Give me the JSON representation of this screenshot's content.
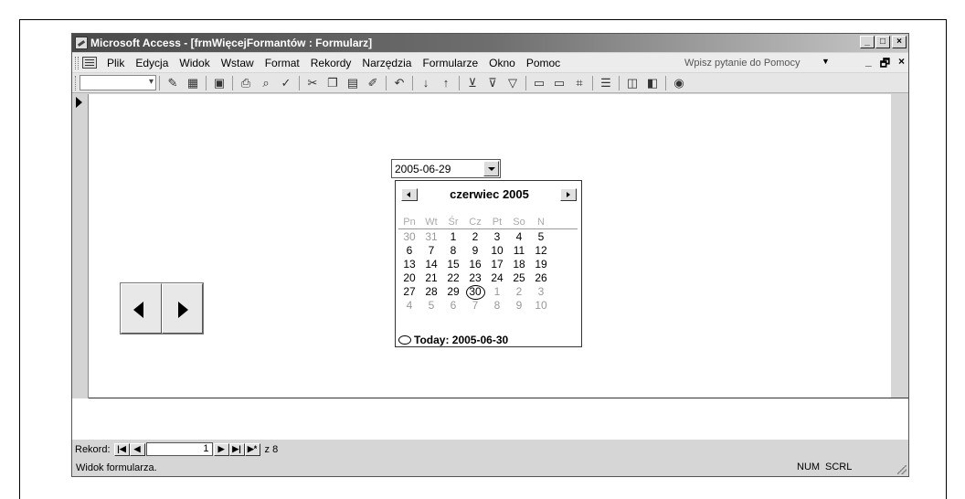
{
  "window": {
    "title": "Microsoft Access - [frmWięcejFormantów : Formularz]",
    "title_buttons": [
      "_",
      "□",
      "×"
    ]
  },
  "menu": {
    "items": [
      "Plik",
      "Edycja",
      "Widok",
      "Wstaw",
      "Format",
      "Rekordy",
      "Narzędzia",
      "Formularze",
      "Okno",
      "Pomoc"
    ],
    "help_placeholder": "Wpisz pytanie do Pomocy",
    "mdi_buttons": [
      "_",
      "🗗",
      "×"
    ]
  },
  "toolbar": {
    "icons": [
      "view-icon",
      "datasheet-icon",
      "save-icon",
      "print-icon",
      "preview-icon",
      "spelling-icon",
      "cut-icon",
      "copy-icon",
      "paste-icon",
      "format-painter-icon",
      "undo-icon",
      "sort-asc-icon",
      "sort-desc-icon",
      "filter-selection-icon",
      "filter-form-icon",
      "apply-filter-icon",
      "new-record-icon",
      "delete-record-icon",
      "find-icon",
      "properties-icon",
      "database-window-icon",
      "new-object-icon",
      "help-icon"
    ]
  },
  "form": {
    "date_value": "2005-06-29",
    "calendar": {
      "month_title": "czerwiec 2005",
      "weekdays": [
        "Pn",
        "Wt",
        "Śr",
        "Cz",
        "Pt",
        "So",
        "N"
      ],
      "weeks": [
        [
          "30",
          "31",
          "1",
          "2",
          "3",
          "4",
          "5"
        ],
        [
          "6",
          "7",
          "8",
          "9",
          "10",
          "11",
          "12"
        ],
        [
          "13",
          "14",
          "15",
          "16",
          "17",
          "18",
          "19"
        ],
        [
          "20",
          "21",
          "22",
          "23",
          "24",
          "25",
          "26"
        ],
        [
          "27",
          "28",
          "29",
          "30",
          "1",
          "2",
          "3"
        ],
        [
          "4",
          "5",
          "6",
          "7",
          "8",
          "9",
          "10"
        ]
      ],
      "today_label": "Today: 2005-06-30",
      "selected_day": "29",
      "today_day": "30"
    }
  },
  "record_nav": {
    "label": "Rekord:",
    "current": "1",
    "of_text": "z 8"
  },
  "status": {
    "text": "Widok formularza.",
    "num": "NUM",
    "scrl": "SCRL"
  }
}
